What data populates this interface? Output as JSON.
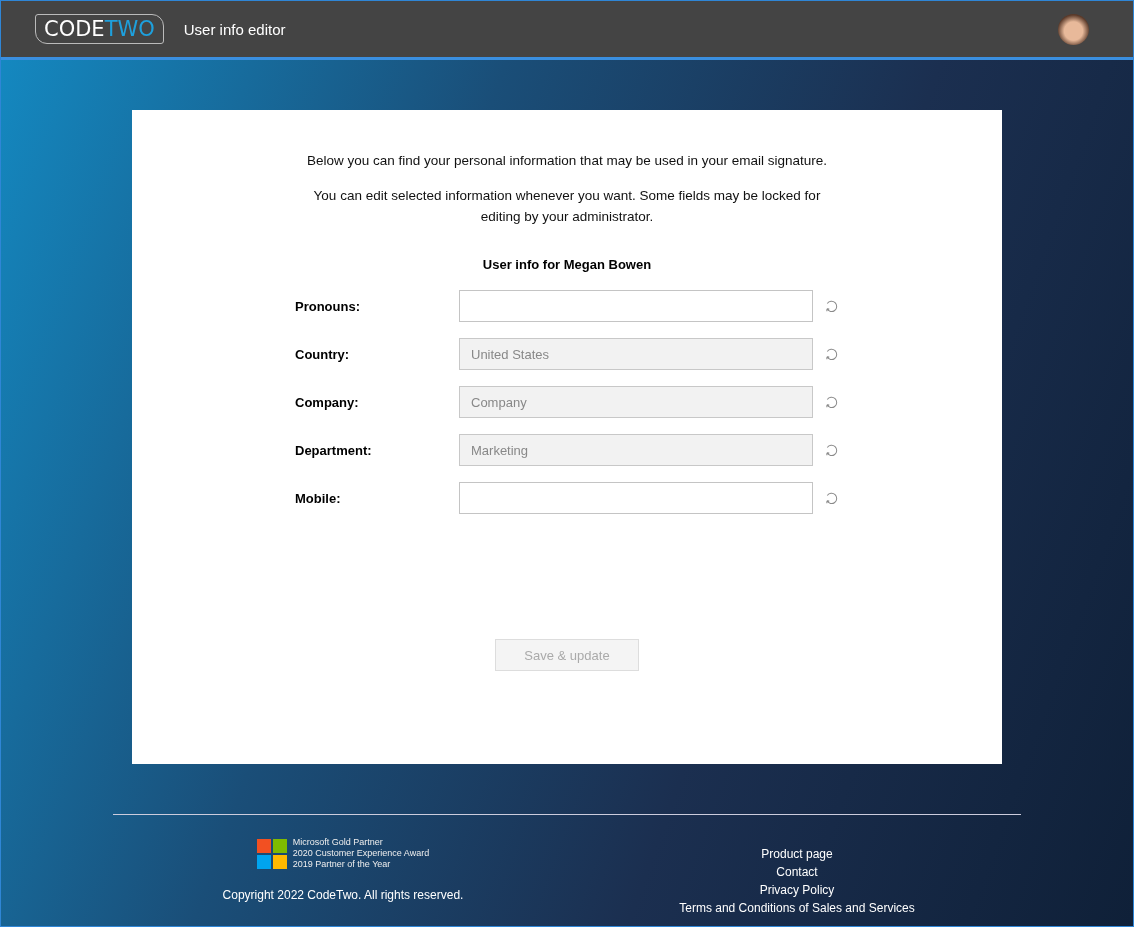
{
  "header": {
    "logo": {
      "first": "CODE",
      "second": "TWO"
    },
    "title": "User info editor"
  },
  "intro": [
    "Below you can find your personal information that may be used in your email signature.",
    "You can edit selected information whenever you want. Some fields may be locked for editing by your administrator."
  ],
  "form": {
    "heading": "User info for Megan Bowen",
    "fields": [
      {
        "label": "Pronouns:",
        "disabled": false
      },
      {
        "label": "Country:",
        "value": "United States",
        "disabled": true
      },
      {
        "label": "Company:",
        "value": "Company",
        "disabled": true
      },
      {
        "label": "Department:",
        "value": "Marketing",
        "disabled": true
      },
      {
        "label": "Mobile:",
        "disabled": false
      }
    ],
    "save_button": {
      "label": "Save & update",
      "disabled": true
    }
  },
  "footer": {
    "awards": [
      "Microsoft Gold Partner",
      "2020 Customer Experience Award",
      "2019 Partner of the Year"
    ],
    "copyright": "Copyright 2022 CodeTwo. All rights reserved.",
    "links": [
      "Product page",
      "Contact",
      "Privacy Policy",
      "Terms and Conditions of Sales and Services"
    ]
  }
}
